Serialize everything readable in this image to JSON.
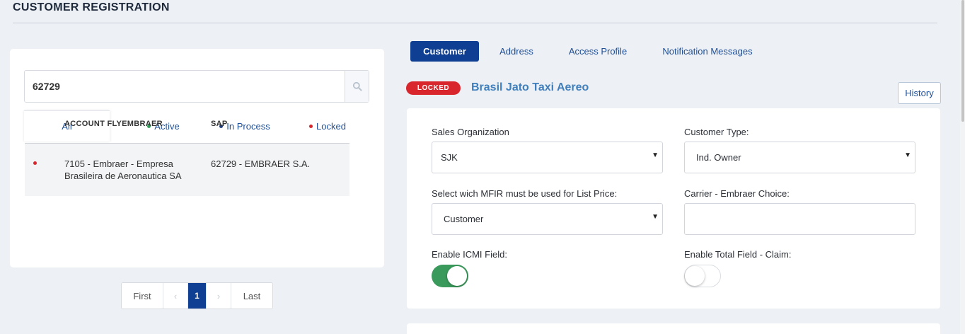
{
  "page": {
    "title": "CUSTOMER REGISTRATION"
  },
  "search": {
    "value": "62729",
    "icon": "search-icon"
  },
  "filters": [
    {
      "label": "All",
      "active": true
    },
    {
      "label": "Active",
      "dot_color": "#2e9b57"
    },
    {
      "label": "In Process",
      "dot_color": "#1e3c7a"
    },
    {
      "label": "Locked",
      "dot_color": "#d9262c"
    }
  ],
  "table": {
    "columns": [
      "ACCOUNT FLYEMBRAER",
      "SAP"
    ],
    "rows": [
      {
        "status_color": "#d9262c",
        "account_line1": "7105 - Embraer - Empresa",
        "account_line2": "Brasileira de Aeronautica SA",
        "sap": "62729 - EMBRAER S.A."
      }
    ]
  },
  "pagination": {
    "first": "First",
    "prev": "‹",
    "current": "1",
    "next": "›",
    "last": "Last"
  },
  "tabs": [
    "Customer",
    "Address",
    "Access Profile",
    "Notification Messages"
  ],
  "customer": {
    "status_badge": "LOCKED",
    "status_color": "#d9262c",
    "name": "Brasil Jato Taxi Aereo",
    "history_label": "History"
  },
  "form": {
    "sales_org": {
      "label": "Sales Organization",
      "value": "SJK"
    },
    "customer_type": {
      "label": "Customer Type:",
      "value": "Ind. Owner"
    },
    "mfir": {
      "label": "Select wich MFIR must be used for List Price:",
      "value": "Customer"
    },
    "carrier": {
      "label": "Carrier - Embraer Choice:",
      "value": ""
    },
    "icmi": {
      "label": "Enable ICMI Field:",
      "enabled": true
    },
    "total_claim": {
      "label": "Enable Total Field - Claim:",
      "enabled": false
    }
  },
  "colors": {
    "primary": "#0f3f93",
    "link": "#1f4f96",
    "accent_name": "#3f7fbd",
    "toggle_on": "#3a9a5b",
    "background": "#edf0f4"
  }
}
